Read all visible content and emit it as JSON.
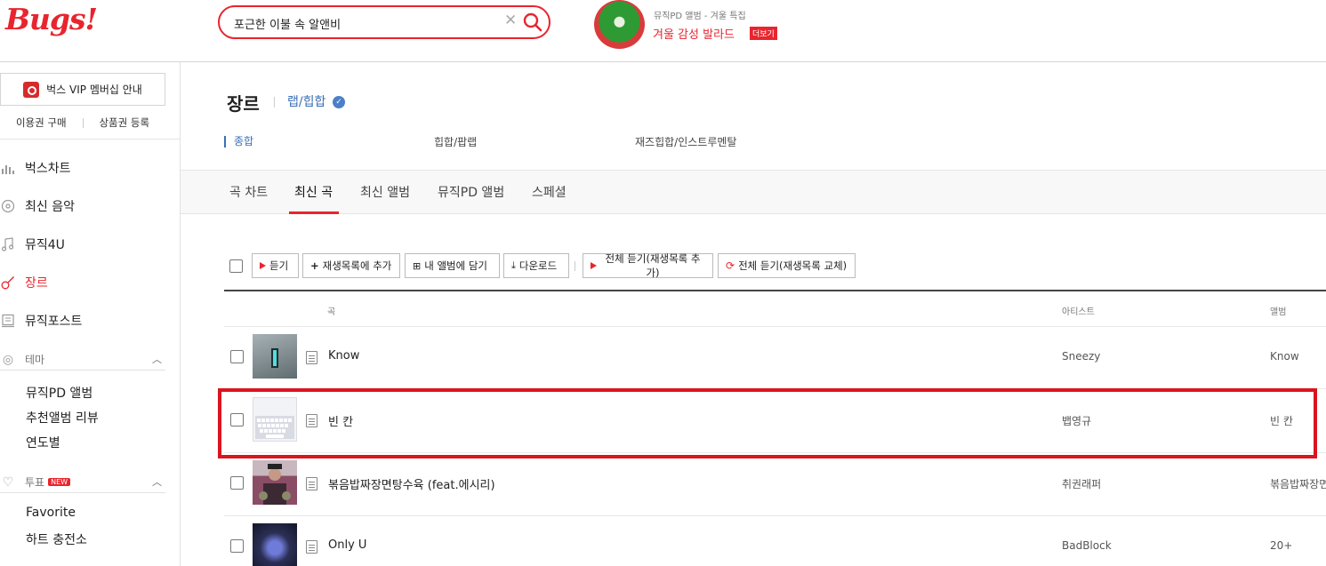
{
  "header": {
    "logo": "Bugs!",
    "search": {
      "value": "포근한 이불 속 알앤비"
    },
    "promo": {
      "subtitle": "뮤직PD 앨범 - 겨울 특집",
      "title": "겨울 감성 발라드",
      "more": "더보기"
    }
  },
  "sidebar": {
    "vip": "벅스 VIP 멤버십 안내",
    "links": [
      "이용권 구매",
      "상품권 등록"
    ],
    "nav": [
      {
        "label": "벅스차트",
        "icon": "chart-icon"
      },
      {
        "label": "최신 음악",
        "icon": "new-music-icon"
      },
      {
        "label": "뮤직4U",
        "icon": "music-note-icon"
      },
      {
        "label": "장르",
        "icon": "guitar-icon"
      },
      {
        "label": "뮤직포스트",
        "icon": "post-icon"
      }
    ],
    "theme": {
      "label": "테마",
      "items": [
        "뮤직PD 앨범",
        "추천앨범 리뷰",
        "연도별"
      ]
    },
    "vote": {
      "label": "투표",
      "badge": "NEW",
      "items": [
        "Favorite",
        "하트 충전소"
      ]
    }
  },
  "genre": {
    "title": "장르",
    "selected": "랩/힙합",
    "subgenres": [
      "종합",
      "힙합/팝랩",
      "재즈힙합/인스트루멘탈"
    ]
  },
  "tabs": [
    "곡 차트",
    "최신 곡",
    "최신 앨범",
    "뮤직PD 앨범",
    "스페셜"
  ],
  "toolbar": {
    "listen": "듣기",
    "add_playlist": "재생목록에 추가",
    "add_album": "내 앨범에 담기",
    "download": "다운로드",
    "play_all_add": "전체 듣기(재생목록 추가)",
    "play_all_replace": "전체 듣기(재생목록 교체)"
  },
  "columns": {
    "song": "곡",
    "artist": "아티스트",
    "album": "앨범"
  },
  "tracks": [
    {
      "title": "Know",
      "artist": "Sneezy",
      "album": "Know",
      "cover": "#6d7b80"
    },
    {
      "title": "빈 칸",
      "artist": "뱁영규",
      "album": "빈 칸",
      "cover": "#e4e6ee"
    },
    {
      "title": "볶음밥짜장면탕수육 (feat.에시리)",
      "artist": "취권래퍼",
      "album": "볶음밥짜장면",
      "cover": "#7a4a5a"
    },
    {
      "title": "Only U",
      "artist": "BadBlock",
      "album": "20+",
      "cover": "#2b2f55"
    }
  ],
  "colors": {
    "brand": "#e8252e",
    "highlight": "#d9151f",
    "link": "#3b6fb5"
  }
}
